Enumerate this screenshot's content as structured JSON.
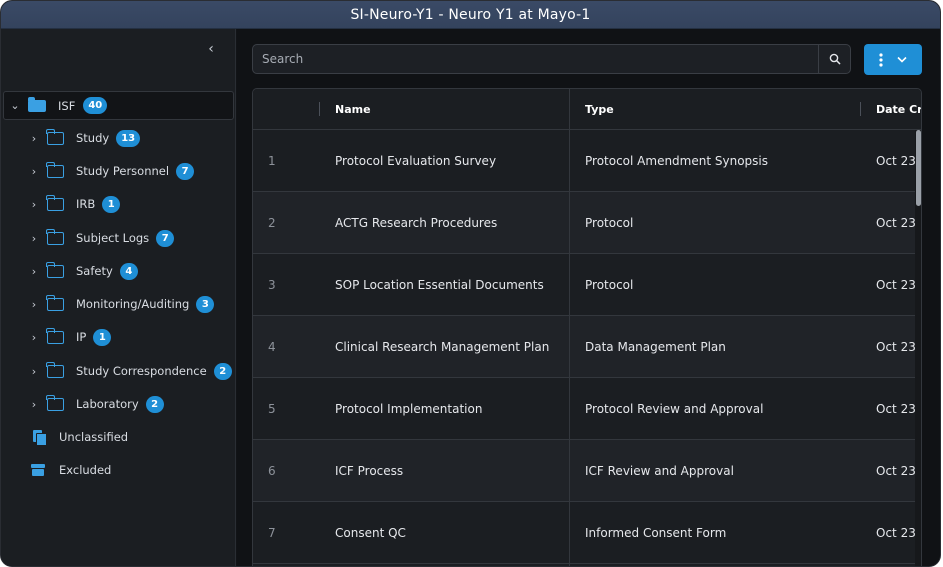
{
  "window": {
    "title": "SI-Neuro-Y1 - Neuro Y1 at Mayo-1"
  },
  "colors": {
    "accent": "#1f8fd6",
    "folder": "#3aa0e3",
    "panel": "#1b1e22",
    "background": "#101215"
  },
  "sidebar": {
    "collapse_icon": "chevron-left-icon",
    "root": {
      "label": "ISF",
      "count": "40",
      "icon": "folder-open-icon",
      "expanded": true
    },
    "folders": [
      {
        "label": "Study",
        "count": "13"
      },
      {
        "label": "Study Personnel",
        "count": "7"
      },
      {
        "label": "IRB",
        "count": "1"
      },
      {
        "label": "Subject Logs",
        "count": "7"
      },
      {
        "label": "Safety",
        "count": "4"
      },
      {
        "label": "Monitoring/Auditing",
        "count": "3"
      },
      {
        "label": "IP",
        "count": "1"
      },
      {
        "label": "Study Correspondence",
        "count": "2"
      },
      {
        "label": "Laboratory",
        "count": "2"
      }
    ],
    "extras": [
      {
        "label": "Unclassified",
        "icon": "documents-icon"
      },
      {
        "label": "Excluded",
        "icon": "archive-icon"
      }
    ]
  },
  "toolbar": {
    "search_placeholder": "Search",
    "search_icon": "magnifier-icon",
    "actions_icons": [
      "kebab-menu-icon",
      "chevron-down-icon"
    ]
  },
  "table": {
    "columns": [
      "Name",
      "Type",
      "Date Cre"
    ],
    "rows": [
      {
        "num": "1",
        "name": "Protocol Evaluation Survey",
        "type": "Protocol Amendment Synopsis",
        "date": "Oct 23"
      },
      {
        "num": "2",
        "name": "ACTG Research Procedures",
        "type": "Protocol",
        "date": "Oct 23"
      },
      {
        "num": "3",
        "name": "SOP Location Essential Documents",
        "type": "Protocol",
        "date": "Oct 23"
      },
      {
        "num": "4",
        "name": "Clinical Research Management Plan",
        "type": "Data Management Plan",
        "date": "Oct 23"
      },
      {
        "num": "5",
        "name": "Protocol Implementation",
        "type": "Protocol Review and Approval",
        "date": "Oct 23"
      },
      {
        "num": "6",
        "name": "ICF Process",
        "type": "ICF Review and Approval",
        "date": "Oct 23"
      },
      {
        "num": "7",
        "name": "Consent QC",
        "type": "Informed Consent Form",
        "date": "Oct 23"
      }
    ]
  }
}
